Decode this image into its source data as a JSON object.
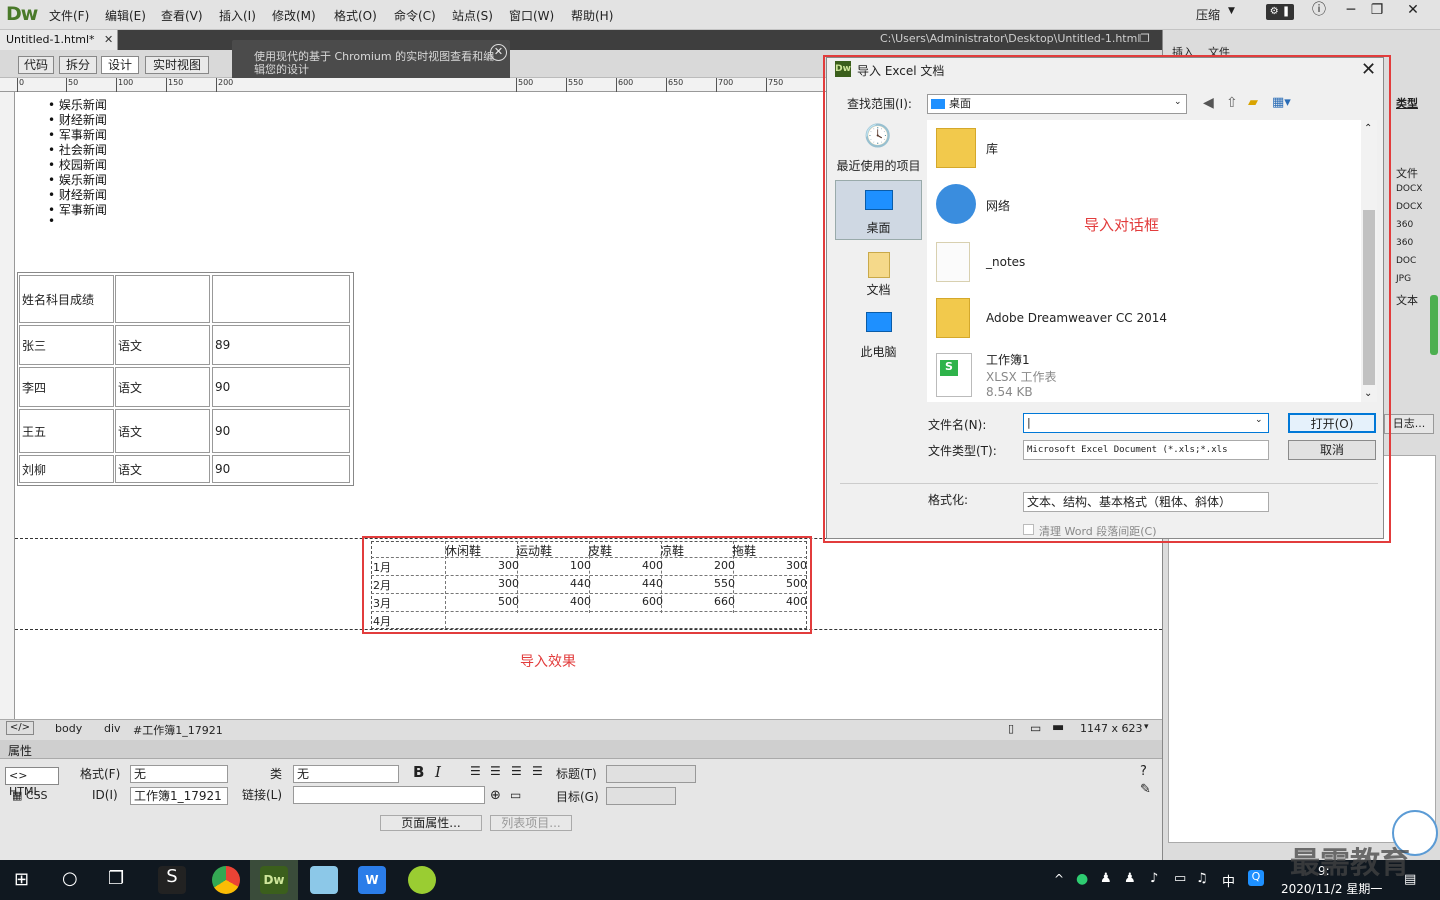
{
  "app": {
    "logo": "Dw",
    "menu": [
      "文件(F)",
      "编辑(E)",
      "查看(V)",
      "插入(I)",
      "修改(M)",
      "格式(O)",
      "命令(C)",
      "站点(S)",
      "窗口(W)",
      "帮助(H)"
    ],
    "compress": "压缩",
    "doc_tab": "Untitled-1.html*",
    "doc_path": "C:\\Users\\Administrator\\Desktop\\Untitled-1.html"
  },
  "viewbar": {
    "buttons": [
      "代码",
      "拆分",
      "设计",
      "实时视图"
    ],
    "tooltip": "使用现代的基于 Chromium 的实时视图查看和编辑您的设计"
  },
  "ruler": {
    "h": [
      "0",
      "50",
      "100",
      "150",
      "200",
      "500",
      "550",
      "600",
      "650",
      "700",
      "750"
    ]
  },
  "design": {
    "news": [
      "娱乐新闻",
      "财经新闻",
      "军事新闻",
      "社会新闻",
      "校园新闻",
      "娱乐新闻",
      "财经新闻",
      "军事新闻",
      ""
    ],
    "table1": [
      [
        "姓名科目成绩",
        "",
        ""
      ],
      [
        "张三",
        "语文",
        "89"
      ],
      [
        "李四",
        "语文",
        "90"
      ],
      [
        "王五",
        "语文",
        "90"
      ],
      [
        "刘柳",
        "语文",
        "90"
      ]
    ],
    "table2": {
      "headers": [
        "",
        "休闲鞋",
        "运动鞋",
        "皮鞋",
        "凉鞋",
        "拖鞋"
      ],
      "rows": [
        [
          "1月",
          "300",
          "100",
          "400",
          "200",
          "300"
        ],
        [
          "2月",
          "300",
          "440",
          "440",
          "550",
          "500"
        ],
        [
          "3月",
          "500",
          "400",
          "600",
          "660",
          "400"
        ],
        [
          "4月",
          "",
          "",
          "",
          "",
          ""
        ]
      ]
    },
    "effect_label": "导入效果"
  },
  "status": {
    "crumbs": [
      "body",
      "div",
      "#工作簿1_17921"
    ],
    "size": "1147 x 623"
  },
  "props": {
    "title": "属性",
    "html": "HTML",
    "css": "CSS",
    "format_label": "格式(F)",
    "format_value": "无",
    "class_label": "类",
    "class_value": "无",
    "id_label": "ID(I)",
    "id_value": "工作簿1_17921",
    "link_label": "链接(L)",
    "heading_label": "标题(T)",
    "target_label": "目标(G)",
    "page_props": "页面属性...",
    "list_item": "列表项目..."
  },
  "rpanel": {
    "tabs": [
      "插入",
      "文件"
    ],
    "type_label": "类型",
    "file_label": "文件",
    "types": [
      "DOCX",
      "DOCX",
      "360",
      "360",
      "DOC",
      "JPG",
      "文本"
    ],
    "log": "日志..."
  },
  "dialog": {
    "title": "导入 Excel 文档",
    "lookin_label": "查找范围(I):",
    "lookin_value": "桌面",
    "places": [
      "最近使用的项目",
      "桌面",
      "文档",
      "此电脑"
    ],
    "files": [
      {
        "name": "库"
      },
      {
        "name": "网络"
      },
      {
        "name": "_notes"
      },
      {
        "name": "Adobe Dreamweaver CC 2014"
      },
      {
        "name": "工作簿1",
        "type": "XLSX 工作表",
        "size": "8.54 KB"
      }
    ],
    "filename_label": "文件名(N):",
    "filetype_label": "文件类型(T):",
    "filetype_value": "Microsoft Excel Document (*.xls;*.xls",
    "open_btn": "打开(O)",
    "cancel_btn": "取消",
    "format_label": "格式化:",
    "format_value": "文本、结构、基本格式（粗体、斜体）",
    "checkbox_label": "清理 Word 段落间距(C)",
    "annotation": "导入对话框"
  },
  "taskbar": {
    "time": "9:",
    "date": "2020/11/2 星期一",
    "ime": "中"
  },
  "watermark": "最需教育",
  "colors": {
    "annotation": "#e23c3c",
    "accent": "#0078d7"
  }
}
